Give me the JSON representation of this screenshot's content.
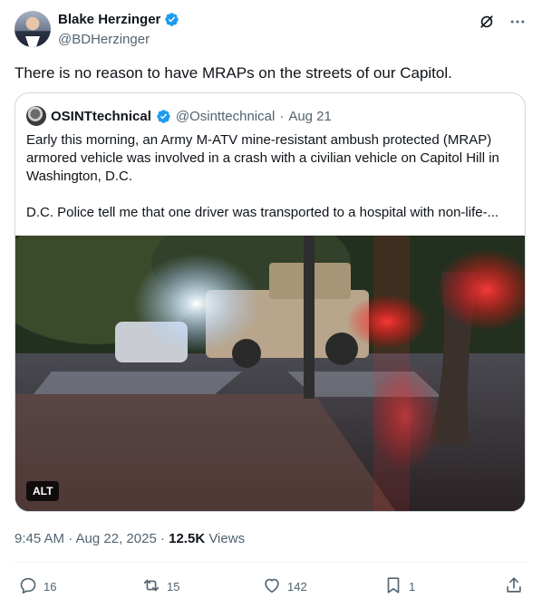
{
  "author": {
    "name": "Blake Herzinger",
    "handle": "@BDHerzinger"
  },
  "tweet": {
    "text": "There is no reason to have MRAPs on the streets of our Capitol."
  },
  "quoted": {
    "name": "OSINTtechnical",
    "handle": "@Osinttechnical",
    "separator": "·",
    "date": "Aug 21",
    "paragraph1": "Early this morning, an Army M-ATV mine-resistant ambush protected (MRAP) armored vehicle was involved in a crash with a civilian vehicle on Capitol Hill in Washington, D.C.",
    "paragraph2": "D.C. Police tell me that one driver was transported to a hospital with non-life-...",
    "alt_label": "ALT"
  },
  "meta": {
    "time": "9:45 AM · Aug 22, 2025 · ",
    "views_count": "12.5K",
    "views_label": " Views"
  },
  "actions": {
    "replies": "16",
    "reposts": "15",
    "likes": "142",
    "bookmarks": "1"
  },
  "icons": {
    "verified": "verified-badge-icon",
    "grok": "grok-icon",
    "more": "more-icon",
    "reply": "reply-icon",
    "repost": "repost-icon",
    "like": "heart-icon",
    "bookmark": "bookmark-icon",
    "share": "share-icon"
  },
  "colors": {
    "verified": "#1d9bf0",
    "text_primary": "#0f1419",
    "text_secondary": "#536471",
    "border": "#cfd9de"
  }
}
